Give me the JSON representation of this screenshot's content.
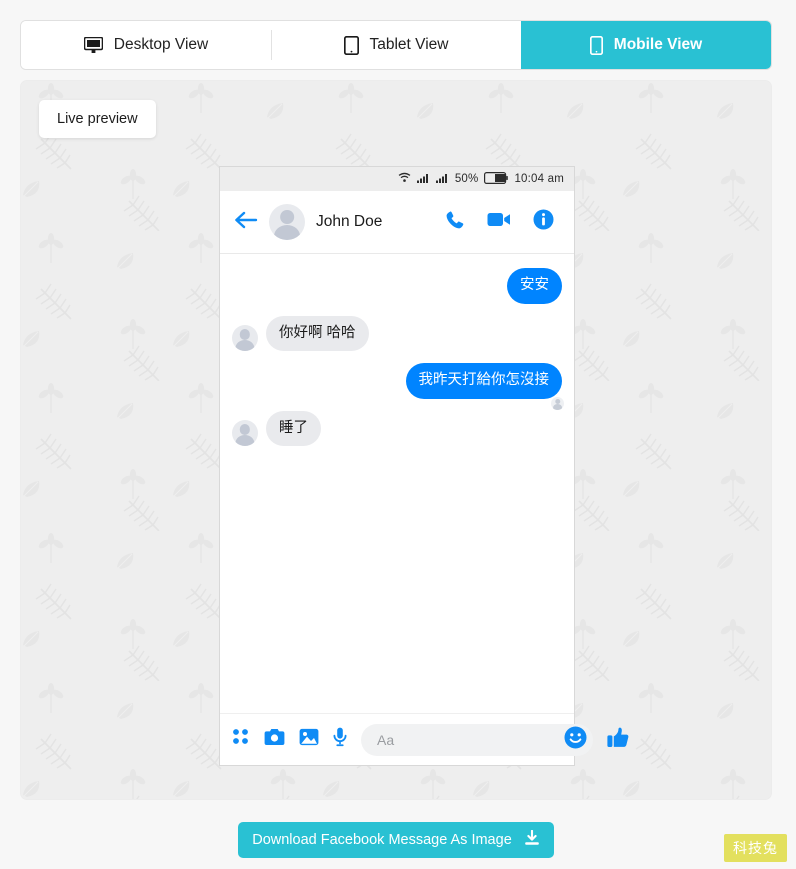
{
  "tabs": [
    {
      "label": "Desktop View",
      "icon": "desktop-monitor-icon",
      "active": false
    },
    {
      "label": "Tablet View",
      "icon": "tablet-icon",
      "active": false
    },
    {
      "label": "Mobile View",
      "icon": "mobile-phone-icon",
      "active": true
    }
  ],
  "preview": {
    "badge_label": "Live preview",
    "background_color": "#eeeeee",
    "pattern": "leaf-fern-pattern"
  },
  "phone": {
    "statusbar": {
      "wifi_icon": "wifi-icon",
      "signal_icon_1": "signal-bars-icon",
      "signal_icon_2": "signal-bars-icon",
      "battery_percent": "50%",
      "battery_icon": "battery-half-icon",
      "time": "10:04 am"
    },
    "header": {
      "back_icon": "back-arrow-icon",
      "avatar": "contact-avatar",
      "name": "John Doe",
      "call_icon": "phone-call-icon",
      "video_icon": "video-camera-icon",
      "info_icon": "info-circle-icon"
    },
    "messages": [
      {
        "side": "out",
        "text": "安安",
        "seen": false
      },
      {
        "side": "in",
        "text": "你好啊 哈哈",
        "seen": false
      },
      {
        "side": "out",
        "text": "我昨天打給你怎沒接",
        "seen": true
      },
      {
        "side": "in",
        "text": "睡了",
        "seen": false
      }
    ],
    "composer": {
      "grid_icon": "app-grid-icon",
      "camera_icon": "camera-icon",
      "photo_icon": "photo-image-icon",
      "mic_icon": "microphone-icon",
      "input_value": "",
      "input_placeholder": "Aa",
      "emoji_icon": "smiley-face-icon",
      "like_icon": "thumbs-up-icon"
    }
  },
  "download": {
    "label": "Download Facebook Message As Image",
    "icon": "download-icon"
  },
  "watermark": {
    "label": "科技兔"
  },
  "colors": {
    "accent_teal": "#29c1d3",
    "messenger_blue": "#0084ff",
    "incoming_bubble": "#e9eaed",
    "watermark_bg": "#e3e05e"
  }
}
